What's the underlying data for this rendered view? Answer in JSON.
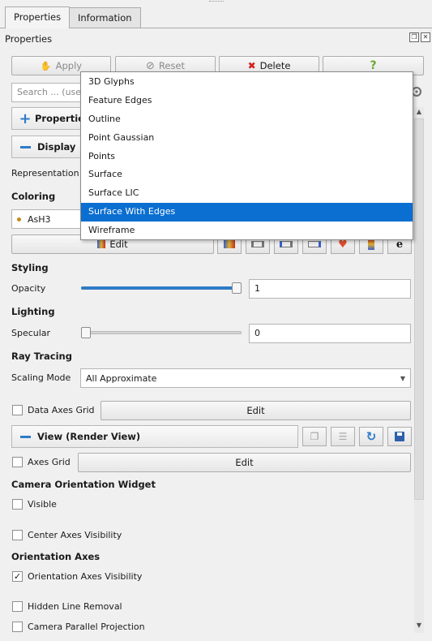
{
  "tabs": [
    {
      "label": "Properties"
    },
    {
      "label": "Information"
    }
  ],
  "panel": {
    "title": "Properties"
  },
  "toolbar": {
    "apply": "Apply",
    "reset": "Reset",
    "delete": "Delete",
    "help": "?"
  },
  "search": {
    "placeholder": "Search ... (use"
  },
  "sections": {
    "properties": "Propertie",
    "display": "Display",
    "view": "View (Render View)"
  },
  "representation": {
    "label": "Representation"
  },
  "coloring": {
    "label": "Coloring",
    "array": "AsH3",
    "edit": "Edit"
  },
  "styling": {
    "label": "Styling",
    "opacity_label": "Opacity",
    "opacity_value": "1",
    "opacity_fraction": 1.0
  },
  "lighting": {
    "label": "Lighting",
    "specular_label": "Specular",
    "specular_value": "0",
    "specular_fraction": 0.0
  },
  "ray_tracing": {
    "label": "Ray Tracing",
    "scaling_label": "Scaling Mode",
    "scaling_value": "All Approximate"
  },
  "data_axes_grid": {
    "label": "Data Axes Grid",
    "checked": false,
    "edit": "Edit"
  },
  "axes_grid": {
    "label": "Axes Grid",
    "checked": false,
    "edit": "Edit"
  },
  "camera_widget": {
    "label": "Camera Orientation Widget",
    "visible_label": "Visible",
    "visible_checked": false
  },
  "center_axes": {
    "label": "Center Axes Visibility",
    "checked": false
  },
  "orientation_axes": {
    "label": "Orientation Axes",
    "visibility_label": "Orientation Axes Visibility",
    "visibility_checked": true
  },
  "hidden_line": {
    "label": "Hidden Line Removal",
    "checked": false
  },
  "parallel_projection": {
    "label": "Camera Parallel Projection",
    "checked": false
  },
  "dropdown": {
    "items": [
      "3D Glyphs",
      "Feature Edges",
      "Outline",
      "Point Gaussian",
      "Points",
      "Surface",
      "Surface LIC",
      "Surface With Edges",
      "Wireframe"
    ],
    "selected": "Surface With Edges"
  },
  "colors": {
    "accent": "#2f7bc8",
    "selection": "#0a6fd1",
    "delete": "#d62020",
    "help": "#6aa832"
  }
}
